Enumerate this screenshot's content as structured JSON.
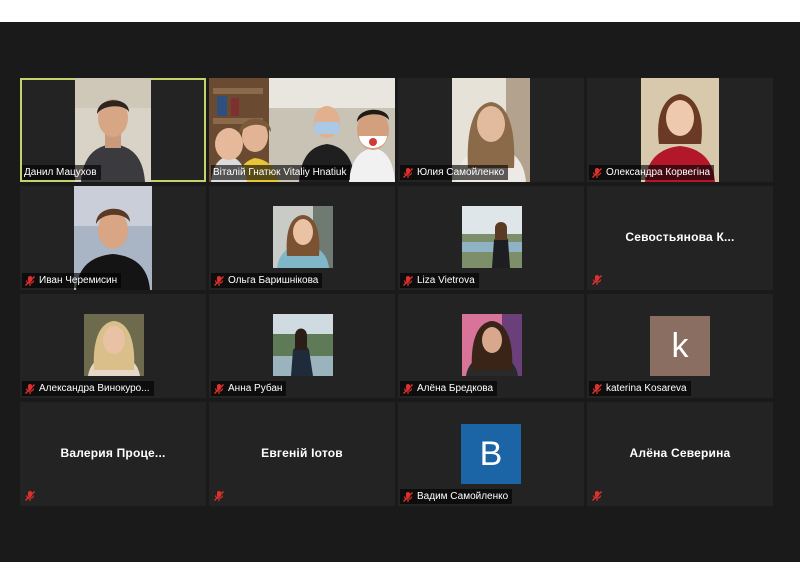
{
  "colors": {
    "stage_bg": "#1a1a1a",
    "tile_bg": "#232323",
    "active_border": "#c6d26a",
    "mute_red": "#e0302c"
  },
  "participants": [
    {
      "name": "Данил Мацухов",
      "muted": false,
      "active": true,
      "display": "video"
    },
    {
      "name": "Віталій Гнатюк Vitaliy Hnatiuk",
      "muted": false,
      "display": "video"
    },
    {
      "name": "Юлия Самойленко",
      "muted": true,
      "display": "video"
    },
    {
      "name": "Олександра Корвегіна",
      "muted": true,
      "display": "video"
    },
    {
      "name": "Иван Черемисин",
      "muted": true,
      "display": "video"
    },
    {
      "name": "Ольга Баришнікова",
      "muted": true,
      "display": "photo"
    },
    {
      "name": "Liza Vietrova",
      "muted": true,
      "display": "photo"
    },
    {
      "name": "Севостьянова  К...",
      "muted": true,
      "display": "name"
    },
    {
      "name": "Александра Винокуро...",
      "muted": true,
      "display": "photo"
    },
    {
      "name": "Анна Рубан",
      "muted": true,
      "display": "photo"
    },
    {
      "name": "Алёна Бредкова",
      "muted": true,
      "display": "photo"
    },
    {
      "name": "katerina Kosareva",
      "muted": true,
      "display": "avatar",
      "avatar_letter": "k",
      "avatar_color": "#8a6e62"
    },
    {
      "name": "Валерия  Проце...",
      "muted": true,
      "display": "name"
    },
    {
      "name": "Евгеній Іотов",
      "muted": true,
      "display": "name"
    },
    {
      "name": "Вадим Самойленко",
      "muted": true,
      "display": "avatar",
      "avatar_letter": "B",
      "avatar_color": "#1b64a6"
    },
    {
      "name": "Алёна Северина",
      "muted": true,
      "display": "name"
    }
  ]
}
